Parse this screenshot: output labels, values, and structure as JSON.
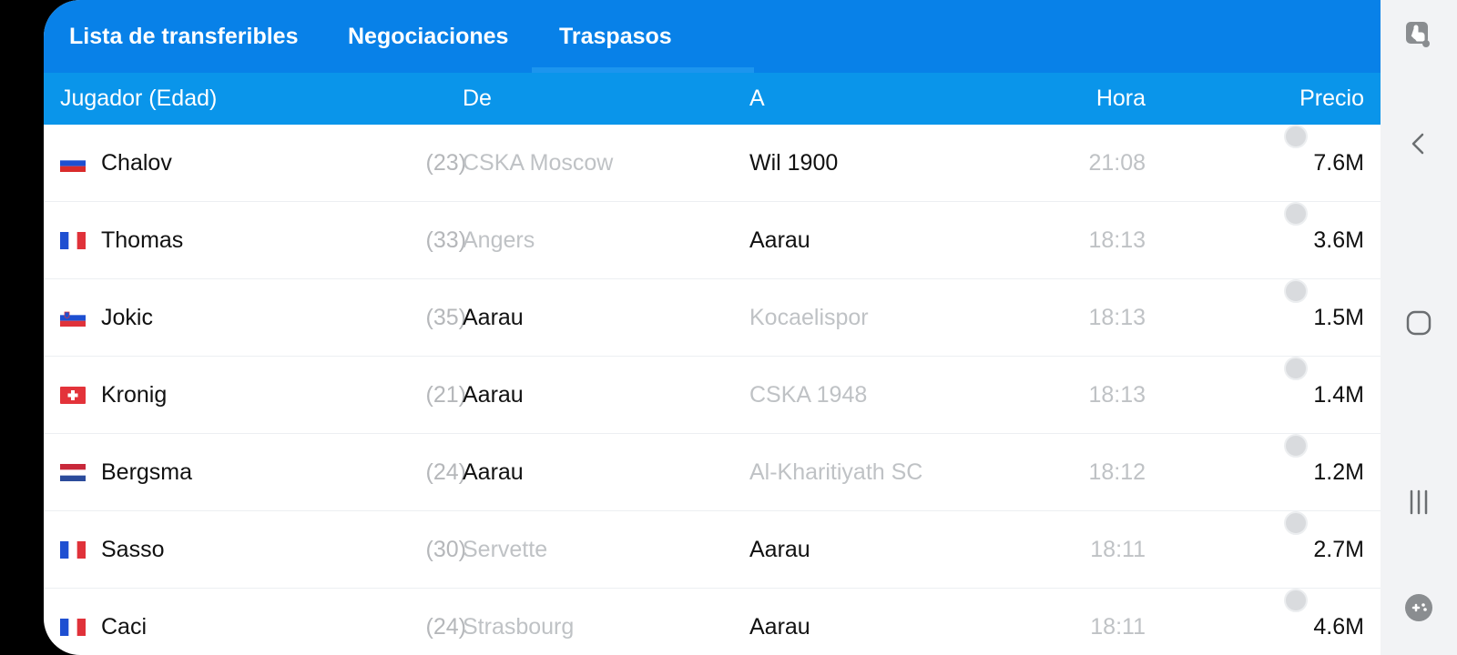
{
  "tabs": [
    {
      "label": "Lista de transferibles",
      "active": false
    },
    {
      "label": "Negociaciones",
      "active": false
    },
    {
      "label": "Traspasos",
      "active": true
    }
  ],
  "header": {
    "player": "Jugador (Edad)",
    "from": "De",
    "to": "A",
    "time": "Hora",
    "price": "Precio"
  },
  "rows": [
    {
      "flag": "russia-flag",
      "name": "Chalov",
      "age": "(23)",
      "from": "CSKA Moscow",
      "to": "Wil 1900",
      "time": "21:08",
      "price": "7.6M"
    },
    {
      "flag": "france-flag",
      "name": "Thomas",
      "age": "(33)",
      "from": "Angers",
      "to": "Aarau",
      "time": "18:13",
      "price": "3.6M"
    },
    {
      "flag": "slovenia-flag",
      "name": "Jokic",
      "age": "(35)",
      "from": "Aarau",
      "to": "Kocaelispor",
      "time": "18:13",
      "price": "1.5M"
    },
    {
      "flag": "switzerland-flag",
      "name": "Kronig",
      "age": "(21)",
      "from": "Aarau",
      "to": "CSKA 1948",
      "time": "18:13",
      "price": "1.4M"
    },
    {
      "flag": "netherlands-flag",
      "name": "Bergsma",
      "age": "(24)",
      "from": "Aarau",
      "to": "Al-Kharitiyath SC",
      "time": "18:12",
      "price": "1.2M"
    },
    {
      "flag": "france-flag",
      "name": "Sasso",
      "age": "(30)",
      "from": "Servette",
      "to": "Aarau",
      "time": "18:11",
      "price": "2.7M"
    },
    {
      "flag": "france-flag",
      "name": "Caci",
      "age": "(24)",
      "from": "Strasbourg",
      "to": "Aarau",
      "time": "18:11",
      "price": "4.6M"
    }
  ],
  "coin_symbol": "S",
  "colors": {
    "tabbar": "#0881e8",
    "header": "#0a95ea",
    "dim_text": "#bfc2c5",
    "strong_text": "#111111"
  },
  "navbar_icons": [
    "screen-touch-icon",
    "back-icon",
    "home-icon",
    "recents-icon",
    "game-launcher-icon"
  ]
}
